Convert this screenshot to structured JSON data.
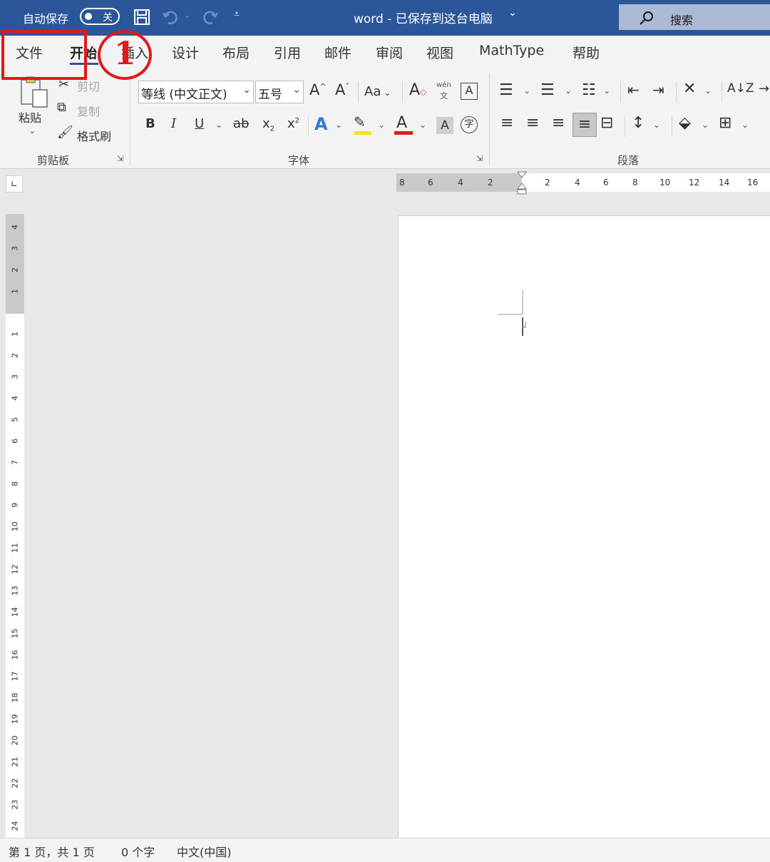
{
  "titlebar": {
    "autosave_label": "自动保存",
    "autosave_state": "关",
    "title": "word  -  已保存到这台电脑",
    "title_caret": "⌄",
    "search_label": "搜索"
  },
  "tabs": [
    "文件",
    "开始",
    "插入",
    "设计",
    "布局",
    "引用",
    "邮件",
    "审阅",
    "视图",
    "MathType",
    "帮助"
  ],
  "active_tab": "开始",
  "ribbon": {
    "clipboard": {
      "paste_label": "粘贴",
      "cut_label": "剪切",
      "copy_label": "复制",
      "format_painter_label": "格式刷",
      "group_label": "剪贴板"
    },
    "font": {
      "font_name": "等线 (中文正文)",
      "font_size": "五号",
      "grow_font": "A",
      "shrink_font": "A",
      "change_case": "Aa",
      "phonetic_top": "wén",
      "phonetic_bottom": "文",
      "char_border": "A",
      "bold": "B",
      "italic": "I",
      "underline": "U",
      "strikethrough": "ab",
      "subscript": "x",
      "superscript": "x",
      "text_effects": "A",
      "font_color": "A",
      "char_shading": "A",
      "enclose_char": "字",
      "group_label": "字体"
    },
    "paragraph": {
      "group_label": "段落",
      "sort_label": "A↓Z"
    },
    "colors": {
      "highlight": "#f5e600",
      "font_color": "#e0191b",
      "accent": "#2b579a"
    }
  },
  "annotation": {
    "marker": "1"
  },
  "ruler": {
    "horizontal_labels": [
      "8",
      "6",
      "4",
      "2",
      "",
      "2",
      "4",
      "6",
      "8",
      "10",
      "12",
      "14",
      "16"
    ],
    "vertical_labels": [
      "4",
      "3",
      "2",
      "1",
      "",
      "1",
      "2",
      "3",
      "4",
      "5",
      "6",
      "7",
      "8",
      "9",
      "10",
      "11",
      "12",
      "13",
      "14",
      "15",
      "16",
      "17",
      "18",
      "19",
      "20",
      "21",
      "22",
      "23",
      "24"
    ]
  },
  "statusbar": {
    "page_info": "第 1 页，共 1 页",
    "word_count": "0 个字",
    "language": "中文(中国)"
  }
}
